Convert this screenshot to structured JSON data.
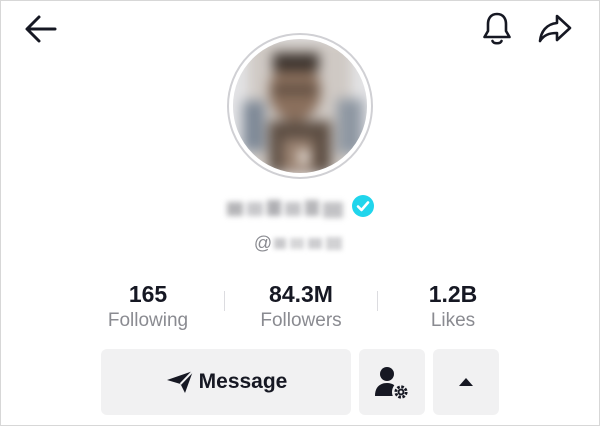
{
  "header": {
    "back_icon": "back-arrow-icon",
    "bell_icon": "bell-icon",
    "share_icon": "share-icon"
  },
  "profile": {
    "handle_prefix": "@",
    "verified_badge_color": "#20d5ec"
  },
  "stats": [
    {
      "value": "165",
      "label": "Following"
    },
    {
      "value": "84.3M",
      "label": "Followers"
    },
    {
      "value": "1.2B",
      "label": "Likes"
    }
  ],
  "actions": {
    "message_label": "Message",
    "message_icon": "send-icon",
    "follow_options_icon": "person-gear-icon",
    "more_icon": "caret-up-icon"
  },
  "colors": {
    "text_primary": "#161823",
    "text_secondary": "#8a8b91",
    "button_bg": "#f1f1f2",
    "verified": "#20d5ec"
  }
}
